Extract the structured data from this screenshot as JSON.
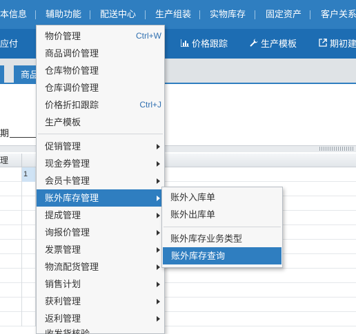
{
  "topmenu": {
    "items": [
      "本信息",
      "辅助功能",
      "配送中心",
      "生产组装",
      "实物库存",
      "固定资产",
      "客户关系"
    ]
  },
  "toolbar": {
    "items": [
      {
        "label": "应付",
        "icon": ""
      },
      {
        "label": "价格跟踪",
        "icon": "bar-chart-icon"
      },
      {
        "label": "生产模板",
        "icon": "wrench-icon"
      },
      {
        "label": "期初建",
        "icon": "external-link-icon"
      }
    ]
  },
  "tabs": {
    "items": [
      "商品"
    ]
  },
  "content": {
    "date_label": "期",
    "grid_header": "理",
    "first_row_value": "1"
  },
  "main_menu": {
    "items": [
      {
        "label": "物价管理",
        "shortcut": "Ctrl+W"
      },
      {
        "label": "商品调价管理",
        "shortcut": ""
      },
      {
        "label": "仓库物价管理",
        "shortcut": ""
      },
      {
        "label": "仓库调价管理",
        "shortcut": ""
      },
      {
        "label": "价格折扣跟踪",
        "shortcut": "Ctrl+J"
      },
      {
        "label": "生产模板",
        "shortcut": ""
      },
      {
        "label": "促销管理",
        "submenu": true
      },
      {
        "label": "现金券管理",
        "submenu": true
      },
      {
        "label": "会员卡管理",
        "submenu": true
      },
      {
        "label": "账外库存管理",
        "submenu": true,
        "highlighted": true
      },
      {
        "label": "提成管理",
        "submenu": true
      },
      {
        "label": "询报价管理",
        "submenu": true
      },
      {
        "label": "发票管理",
        "submenu": true
      },
      {
        "label": "物流配货管理",
        "submenu": true
      },
      {
        "label": "销售计划",
        "submenu": true
      },
      {
        "label": "获利管理",
        "submenu": true
      },
      {
        "label": "返利管理",
        "submenu": true
      },
      {
        "label": "收发货核验",
        "submenu": false
      }
    ]
  },
  "sub_menu": {
    "items": [
      {
        "label": "账外入库单"
      },
      {
        "label": "账外出库单"
      },
      {
        "label": "账外库存业务类型"
      },
      {
        "label": "账外库存查询",
        "highlighted": true
      }
    ]
  },
  "colors": {
    "top_bar": "#2f7ec0",
    "toolbar": "#1d6db3",
    "highlight": "#2f7ec0",
    "menu_bg": "#f7f7f7"
  }
}
